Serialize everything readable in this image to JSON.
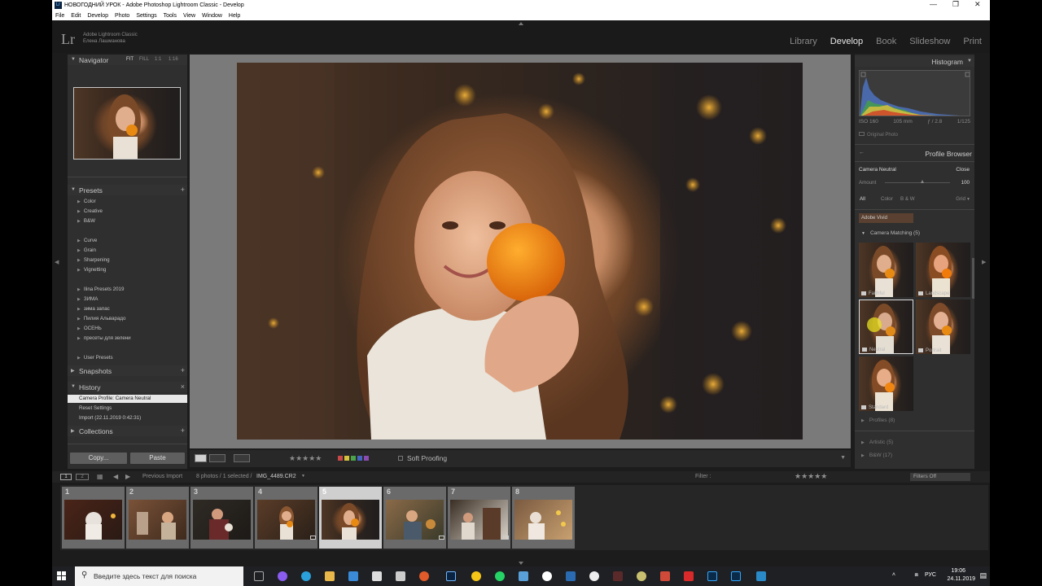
{
  "window": {
    "title": "НОВОГОДНИЙ УРОК - Adobe Photoshop Lightroom Classic - Develop",
    "menu": [
      "File",
      "Edit",
      "Develop",
      "Photo",
      "Settings",
      "Tools",
      "View",
      "Window",
      "Help"
    ]
  },
  "identity": {
    "logo": "Lr",
    "product": "Adobe Lightroom Classic",
    "user": "Елена Лашманова"
  },
  "modules": [
    "Library",
    "Develop",
    "Book",
    "Slideshow",
    "Print"
  ],
  "left_panel": {
    "navigator": {
      "title": "Navigator",
      "zoom_options": [
        "FIT",
        "FILL",
        "1:1",
        "1:16"
      ]
    },
    "presets": {
      "title": "Presets",
      "groups": [
        [
          "Color",
          "Creative",
          "B&W"
        ],
        [
          "Curve",
          "Grain",
          "Sharpening",
          "Vignetting"
        ],
        [
          "Ilina Presets 2019",
          "ЗИМА",
          "зима запас",
          "Пилия Альварадо",
          "ОСЕНЬ",
          "пресеты для зелени"
        ],
        [
          "User Presets"
        ]
      ]
    },
    "snapshots": {
      "title": "Snapshots"
    },
    "history": {
      "title": "History",
      "close": "×",
      "items": [
        "Camera Profile: Camera Neutral",
        "Reset Settings",
        "Import (22.11.2019 0:42:31)"
      ]
    },
    "collections": {
      "title": "Collections"
    },
    "copy_label": "Copy...",
    "paste_label": "Paste"
  },
  "toolbar": {
    "rating": "★★★★★",
    "flag_colors": [
      "#c84848",
      "#d4c23c",
      "#4aa24a",
      "#4466c0",
      "#8a4cb0"
    ],
    "soft_proofing": "Soft Proofing"
  },
  "right_panel": {
    "histogram": {
      "title": "Histogram",
      "iso": "ISO 160",
      "focal": "105 mm",
      "aperture": "ƒ / 2.8",
      "shutter": "1/125",
      "original_photo": "Original Photo"
    },
    "profile_browser": {
      "title": "Profile Browser",
      "current": "Camera Neutral",
      "close": "Close",
      "amount_label": "Amount",
      "amount_value": "100",
      "filter_tabs": [
        "All",
        "Color",
        "B & W"
      ],
      "view_mode": "Grid",
      "peek_label": "Adobe Vivid",
      "camera_matching": "Camera Matching (5)",
      "profiles": [
        "Faithful",
        "Landscape",
        "Neutral",
        "Portrait",
        "Standard"
      ],
      "collapsed_groups": [
        "Profiles (8)",
        "Artistic (5)",
        "B&W (17)"
      ]
    }
  },
  "filmstrip": {
    "source": "Previous Import",
    "count_text": "8 photos / 1 selected /",
    "filename": "IMG_4489.CR2",
    "filter_label": "Filter :",
    "filters_off": "Filters Off",
    "frames": [
      "1",
      "2",
      "3",
      "4",
      "5",
      "6",
      "7",
      "8"
    ],
    "selected_index": 5
  },
  "taskbar": {
    "search_placeholder": "Введите здесь текст для поиска",
    "lang": "РУС",
    "time": "19:06",
    "date": "24.11.2019"
  }
}
